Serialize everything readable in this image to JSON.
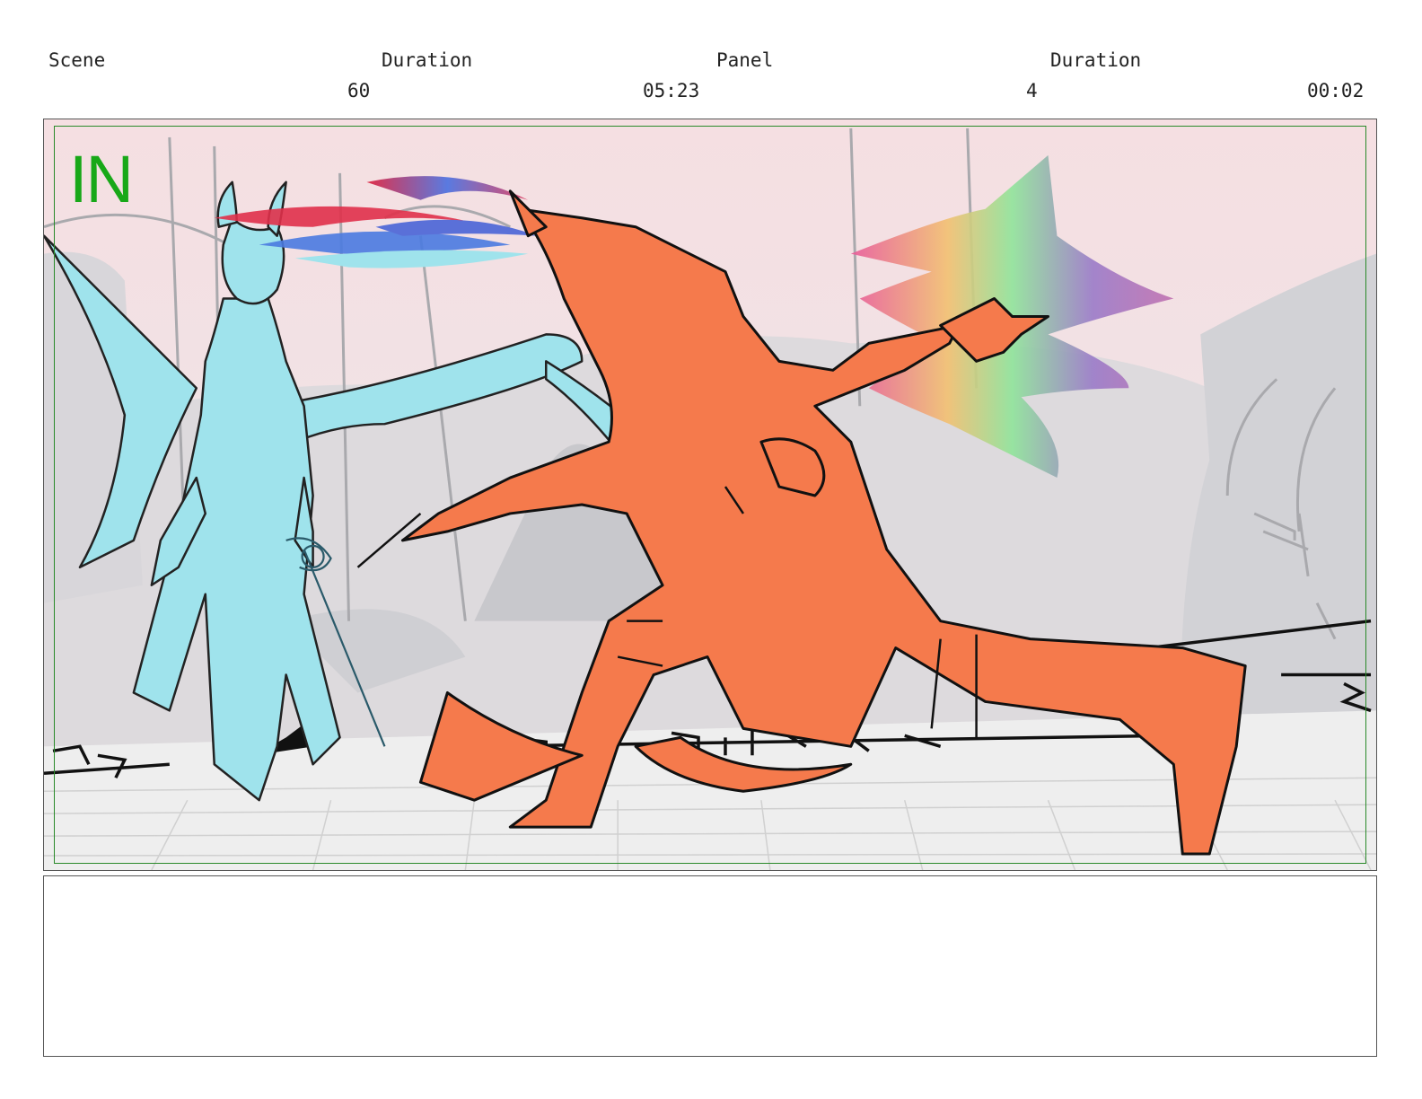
{
  "header": {
    "scene_label": "Scene",
    "duration_label_1": "Duration",
    "panel_label": "Panel",
    "duration_label_2": "Duration",
    "scene_value": "60",
    "scene_duration_value": "05:23",
    "panel_value": "4",
    "panel_duration_value": "00:02"
  },
  "panel": {
    "in_marker": "IN"
  },
  "notes": {
    "text": ""
  }
}
